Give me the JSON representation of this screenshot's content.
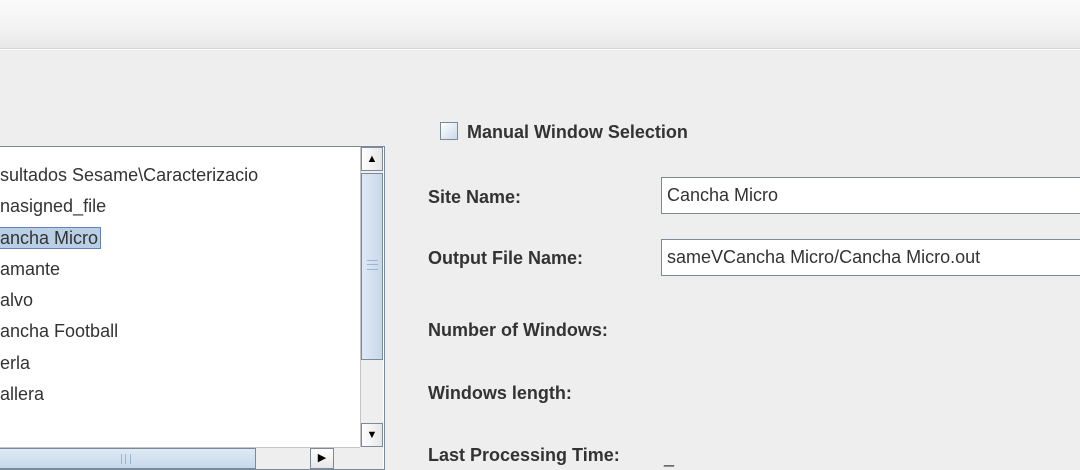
{
  "list": {
    "items": [
      "sultados Sesame\\Caracterizacio",
      "nasigned_file",
      "ancha Micro",
      "amante",
      "alvo",
      "ancha Football",
      "erla",
      "allera"
    ],
    "selected_index": 2
  },
  "scrollbar_icons": {
    "up": "▲",
    "down": "▼",
    "right": "▶"
  },
  "form": {
    "manual_window_selection": {
      "label": "Manual Window Selection",
      "checked": false
    },
    "site_name": {
      "label": "Site Name:",
      "value": "Cancha Micro"
    },
    "output_file_name": {
      "label": "Output File Name:",
      "value": "sameVCancha Micro/Cancha Micro.out"
    },
    "number_of_windows": {
      "label": "Number of Windows:",
      "value": ""
    },
    "windows_length": {
      "label": "Windows length:",
      "value": ""
    },
    "last_processing_time": {
      "label": "Last Processing Time:",
      "value": "_"
    }
  }
}
